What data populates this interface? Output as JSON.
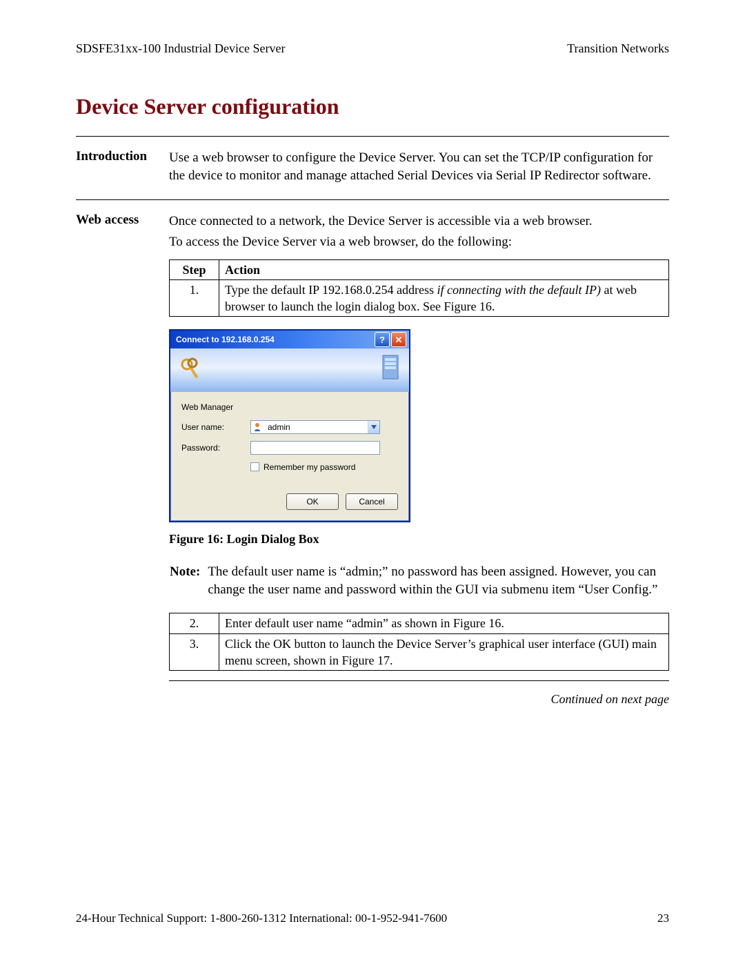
{
  "header": {
    "left": "SDSFE31xx-100 Industrial Device Server",
    "right": "Transition Networks"
  },
  "title": "Device Server configuration",
  "intro": {
    "label": "Introduction",
    "text": "Use a web browser to configure the Device Server. You can set the TCP/IP configuration for the device to monitor and manage attached Serial Devices via Serial IP Redirector software."
  },
  "web_access": {
    "label": "Web access",
    "p1": "Once connected to a network, the Device Server is accessible via a web browser.",
    "p2": "To access the Device Server via a web browser, do the following:"
  },
  "table1": {
    "head_step": "Step",
    "head_action": "Action",
    "row1_step": "1.",
    "row1_a": "Type the default IP 192.168.0.254 address ",
    "row1_b_italic": "if connecting with the default IP)",
    "row1_c": " at web browser to launch the login dialog box. See Figure 16."
  },
  "dialog": {
    "title": "Connect to 192.168.0.254",
    "web_manager": "Web Manager",
    "user_name_label": "User name:",
    "password_label": "Password:",
    "user_value": "admin",
    "remember": "Remember my password",
    "ok": "OK",
    "cancel": "Cancel"
  },
  "fig_caption": "Figure 16:  Login Dialog Box",
  "note": {
    "label": "Note:",
    "text": "The default user name is “admin;” no password has been assigned. However, you can change the user name and password within the GUI via submenu item “User Config.”"
  },
  "table2": {
    "row2_step": "2.",
    "row2_action": "Enter default user name “admin” as shown in Figure 16.",
    "row3_step": "3.",
    "row3_action": "Click the OK button to launch the Device Server’s graphical user interface (GUI) main menu screen, shown in Figure 17."
  },
  "continued": "Continued on next page",
  "footer": {
    "left": "24-Hour Technical Support:  1-800-260-1312   International: 00-1-952-941-7600",
    "page": "23"
  }
}
